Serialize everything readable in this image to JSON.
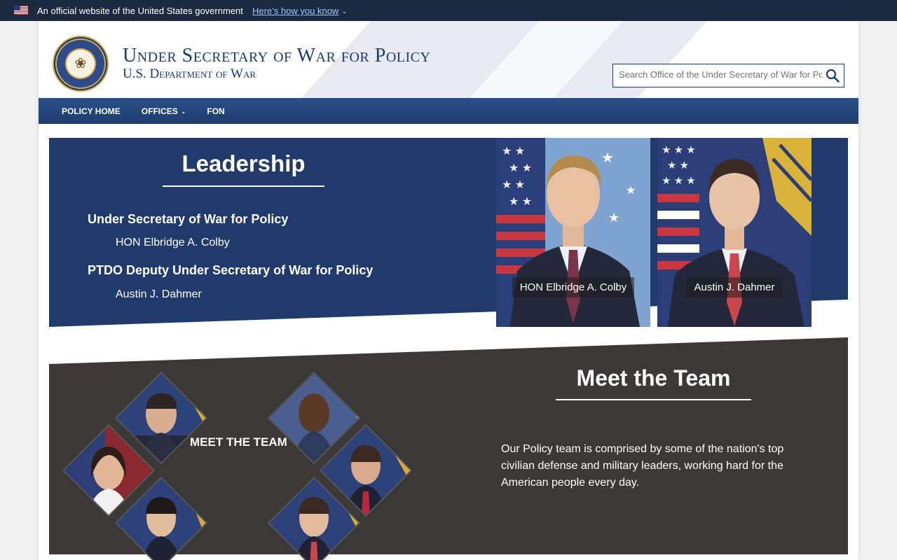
{
  "gov_banner": {
    "text": "An official website of the United States government",
    "link": "Here’s how you know"
  },
  "header": {
    "title": "Under Secretary of War for Policy",
    "subtitle": "U.S. Department of War",
    "search_placeholder": "Search Office of the Under Secretary of War for Policy"
  },
  "nav": {
    "items": [
      {
        "label": "POLICY HOME"
      },
      {
        "label": "OFFICES"
      },
      {
        "label": "FON"
      }
    ]
  },
  "leadership": {
    "title": "Leadership",
    "roles": [
      {
        "role": "Under Secretary of War for Policy",
        "name": "HON Elbridge A. Colby"
      },
      {
        "role": "PTDO Deputy Under Secretary of War for Policy",
        "name": "Austin J. Dahmer"
      }
    ],
    "portraits": [
      {
        "caption": "HON Elbridge A. Colby"
      },
      {
        "caption": "Austin J. Dahmer"
      }
    ]
  },
  "team": {
    "title": "Meet the Team",
    "description": "Our Policy team is comprised by some of the nation's top civilian defense and military leaders, working hard for the American people every day.",
    "graphic_label": "MEET THE TEAM"
  },
  "colors": {
    "banner": "#1b2a41",
    "navy": "#1f3a6b",
    "dark_gray": "#3a3a3a",
    "title_blue": "#1c3a75"
  }
}
